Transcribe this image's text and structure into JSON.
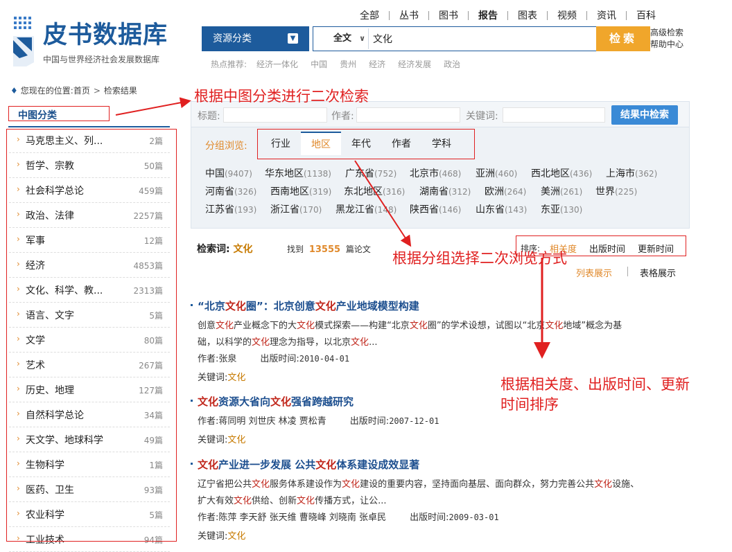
{
  "logo": {
    "title": "皮书数据库",
    "subtitle": "中国与世界经济社会发展数据库"
  },
  "topnav": [
    {
      "label": "全部",
      "bold": false
    },
    {
      "label": "丛书",
      "bold": false
    },
    {
      "label": "图书",
      "bold": false
    },
    {
      "label": "报告",
      "bold": true
    },
    {
      "label": "图表",
      "bold": false
    },
    {
      "label": "视频",
      "bold": false
    },
    {
      "label": "资讯",
      "bold": false
    },
    {
      "label": "百科",
      "bold": false
    }
  ],
  "search": {
    "resource_select": "资源分类",
    "field_select": "全文",
    "query": "文化",
    "button": "检索",
    "advanced": "高级检索",
    "help": "帮助中心"
  },
  "hot": {
    "label": "热点推荐:",
    "words": [
      "经济一体化",
      "中国",
      "贵州",
      "经济",
      "经济发展",
      "政治"
    ]
  },
  "breadcrumb": {
    "prefix": "您现在的位置:",
    "home": "首页",
    "current": "检索结果"
  },
  "sidebar": {
    "title": "中图分类",
    "items": [
      {
        "name": "马克思主义、列...",
        "count": "2篇"
      },
      {
        "name": "哲学、宗教",
        "count": "50篇"
      },
      {
        "name": "社会科学总论",
        "count": "459篇"
      },
      {
        "name": "政治、法律",
        "count": "2257篇"
      },
      {
        "name": "军事",
        "count": "12篇"
      },
      {
        "name": "经济",
        "count": "4853篇"
      },
      {
        "name": "文化、科学、教...",
        "count": "2313篇"
      },
      {
        "name": "语言、文字",
        "count": "5篇"
      },
      {
        "name": "文学",
        "count": "80篇"
      },
      {
        "name": "艺术",
        "count": "267篇"
      },
      {
        "name": "历史、地理",
        "count": "127篇"
      },
      {
        "name": "自然科学总论",
        "count": "34篇"
      },
      {
        "name": "天文学、地球科学",
        "count": "49篇"
      },
      {
        "name": "生物科学",
        "count": "1篇"
      },
      {
        "name": "医药、卫生",
        "count": "93篇"
      },
      {
        "name": "农业科学",
        "count": "5篇"
      },
      {
        "name": "工业技术",
        "count": "94篇"
      }
    ]
  },
  "filter": {
    "title_label": "标题:",
    "author_label": "作者:",
    "keyword_label": "关键词:",
    "refine_button": "结果中检索",
    "group_label": "分组浏览:",
    "tabs": [
      "行业",
      "地区",
      "年代",
      "作者",
      "学科"
    ],
    "active_tab": "地区",
    "regions": [
      [
        {
          "n": "中国",
          "c": "(9407)"
        },
        {
          "n": "华东地区",
          "c": "(1138)"
        },
        {
          "n": "广东省",
          "c": "(752)"
        },
        {
          "n": "北京市",
          "c": "(468)"
        },
        {
          "n": "亚洲",
          "c": "(460)"
        },
        {
          "n": "西北地区",
          "c": "(436)"
        },
        {
          "n": "上海市",
          "c": "(362)"
        }
      ],
      [
        {
          "n": "河南省",
          "c": "(326)"
        },
        {
          "n": "西南地区",
          "c": "(319)"
        },
        {
          "n": "东北地区",
          "c": "(316)"
        },
        {
          "n": "湖南省",
          "c": "(312)"
        },
        {
          "n": "欧洲",
          "c": "(264)"
        },
        {
          "n": "美洲",
          "c": "(261)"
        },
        {
          "n": "世界",
          "c": "(225)"
        }
      ],
      [
        {
          "n": "江苏省",
          "c": "(193)"
        },
        {
          "n": "浙江省",
          "c": "(170)"
        },
        {
          "n": "黑龙江省",
          "c": "(148)"
        },
        {
          "n": "陕西省",
          "c": "(146)"
        },
        {
          "n": "山东省",
          "c": "(143)"
        },
        {
          "n": "东亚",
          "c": "(130)"
        }
      ]
    ]
  },
  "results_bar": {
    "keyword_label": "检索词:",
    "keyword": "文化",
    "found_prefix": "找到",
    "found_count": "13555",
    "found_suffix": "篇论文",
    "sort_label": "排序:",
    "sort_options": [
      "相关度",
      "出版时间",
      "更新时间"
    ],
    "view_list": "列表展示",
    "view_table": "表格展示"
  },
  "results": [
    {
      "title": [
        [
          "“北京",
          false
        ],
        [
          "文化",
          true
        ],
        [
          "圈”：北京创意",
          false
        ],
        [
          "文化",
          true
        ],
        [
          "产业地域模型构建",
          false
        ]
      ],
      "abstract": [
        [
          [
            "创意",
            false
          ],
          [
            "文化",
            true
          ],
          [
            "产业概念下的大",
            false
          ],
          [
            "文化",
            true
          ],
          [
            "模式探索——构建“北京",
            false
          ],
          [
            "文化",
            true
          ],
          [
            "圈”的学术设想，试图以“北京",
            false
          ],
          [
            "文化",
            true
          ],
          [
            "地域”概念为基",
            false
          ]
        ],
        [
          [
            "础，以科学的",
            false
          ],
          [
            "文化",
            true
          ],
          [
            "理念为指导，以北京",
            false
          ],
          [
            "文化",
            true
          ],
          [
            "...",
            false
          ]
        ]
      ],
      "author_label": "作者:",
      "authors": "张泉",
      "date_label": "出版时间:",
      "date": "2010-04-01",
      "keywords_label": "关键词:",
      "keywords": "文化"
    },
    {
      "title": [
        [
          "文化",
          true
        ],
        [
          "资源大省向",
          false
        ],
        [
          "文化",
          true
        ],
        [
          "强省跨越研究",
          false
        ]
      ],
      "abstract": [],
      "author_label": "作者:",
      "authors": "蒋同明 刘世庆 林凌 贾松青",
      "date_label": "出版时间:",
      "date": "2007-12-01",
      "keywords_label": "关键词:",
      "keywords": "文化"
    },
    {
      "title": [
        [
          "文化",
          true
        ],
        [
          "产业进一步发展 公共",
          false
        ],
        [
          "文化",
          true
        ],
        [
          "体系建设成效显著",
          false
        ]
      ],
      "abstract": [
        [
          [
            "辽宁省把公共",
            false
          ],
          [
            "文化",
            true
          ],
          [
            "服务体系建设作为",
            false
          ],
          [
            "文化",
            true
          ],
          [
            "建设的重要内容，坚持面向基层、面向群众，努力完善公共",
            false
          ],
          [
            "文化",
            true
          ],
          [
            "设施、",
            false
          ]
        ],
        [
          [
            "扩大有效",
            false
          ],
          [
            "文化",
            true
          ],
          [
            "供给、创新",
            false
          ],
          [
            "文化",
            true
          ],
          [
            "传播方式，让公...",
            false
          ]
        ]
      ],
      "author_label": "作者:",
      "authors": "陈萍 李天舒 张天维 曹晓峰 刘晓南 张卓民",
      "date_label": "出版时间:",
      "date": "2009-03-01",
      "keywords_label": "关键词:",
      "keywords": "文化"
    }
  ],
  "annotations": {
    "a1": "根据中图分类进行二次检索",
    "a2": "根据分组选择二次浏览方式",
    "a3_line1": "根据相关度、出版时间、更新",
    "a3_line2": "时间排序"
  },
  "colors": {
    "brand": "#1d5b9c",
    "accent": "#f0a62b",
    "highlight": "#c0261b",
    "annotation": "#e02020"
  }
}
